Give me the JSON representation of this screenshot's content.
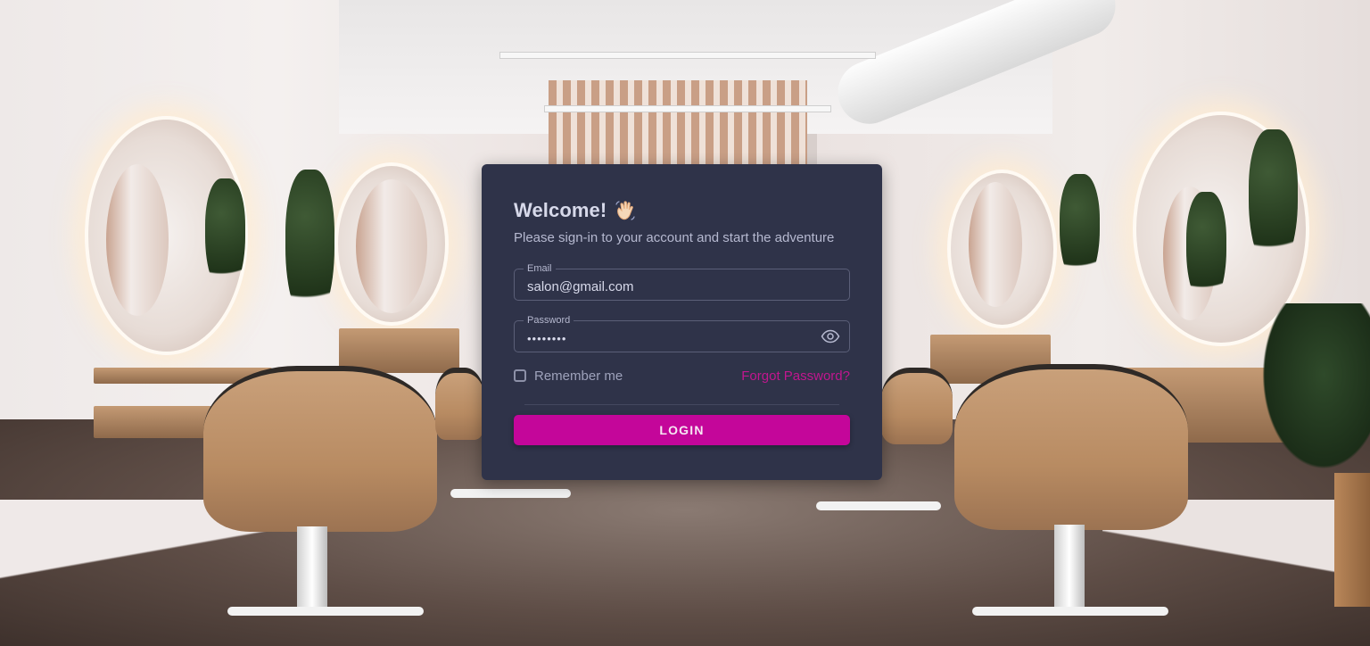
{
  "login": {
    "title": "Welcome!",
    "title_emoji": "waving-hand-icon",
    "subtitle": "Please sign-in to your account and start the adventure",
    "email": {
      "label": "Email",
      "value": "salon@gmail.com"
    },
    "password": {
      "label": "Password",
      "value": "••••••••",
      "toggle_icon": "eye-icon"
    },
    "remember_label": "Remember me",
    "remember_checked": false,
    "forgot_label": "Forgot Password?",
    "login_button": "LOGIN"
  },
  "colors": {
    "card_background": "#2f3349",
    "accent": "#c4069a",
    "link": "#c2168f",
    "text_primary": "#d7d9ea",
    "text_secondary": "#b6b9d0"
  },
  "background": {
    "description_icon": "salon-interior-photo"
  }
}
